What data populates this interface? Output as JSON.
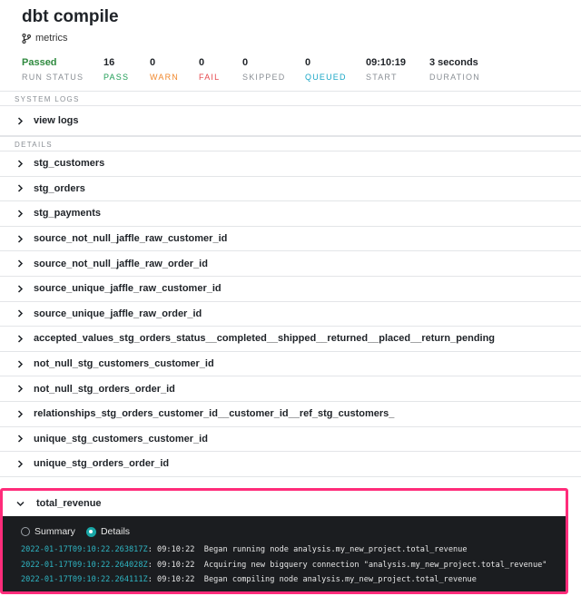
{
  "run": {
    "title": "dbt compile",
    "branch": "metrics"
  },
  "stats": [
    {
      "value": "Passed",
      "label": "RUN STATUS",
      "value_color": "#2f8a3f",
      "label_color": "#8a8f95",
      "width": 90
    },
    {
      "value": "16",
      "label": "PASS",
      "value_color": "#1f2328",
      "label_color": "#1f9d55",
      "width": 51
    },
    {
      "value": "0",
      "label": "WARN",
      "value_color": "#1f2328",
      "label_color": "#f0872c",
      "width": 54
    },
    {
      "value": "0",
      "label": "FAIL",
      "value_color": "#1f2328",
      "label_color": "#e5484d",
      "width": 48
    },
    {
      "value": "0",
      "label": "SKIPPED",
      "value_color": "#1f2328",
      "label_color": "#8a8f95",
      "width": 69
    },
    {
      "value": "0",
      "label": "QUEUED",
      "value_color": "#1f2328",
      "label_color": "#19a6c6",
      "width": 67
    },
    {
      "value": "09:10:19",
      "label": "START",
      "value_color": "#1f2328",
      "label_color": "#8a8f95",
      "width": 70
    },
    {
      "value": "3 seconds",
      "label": "DURATION",
      "value_color": "#1f2328",
      "label_color": "#8a8f95",
      "width": 80
    }
  ],
  "system_logs": {
    "section_label": "SYSTEM LOGS",
    "item": "view logs"
  },
  "details": {
    "section_label": "DETAILS",
    "nodes": [
      "stg_customers",
      "stg_orders",
      "stg_payments",
      "source_not_null_jaffle_raw_customer_id",
      "source_not_null_jaffle_raw_order_id",
      "source_unique_jaffle_raw_customer_id",
      "source_unique_jaffle_raw_order_id",
      "accepted_values_stg_orders_status__completed__shipped__returned__placed__return_pending",
      "not_null_stg_customers_customer_id",
      "not_null_stg_orders_order_id",
      "relationships_stg_orders_customer_id__customer_id__ref_stg_customers_",
      "unique_stg_customers_customer_id",
      "unique_stg_orders_order_id"
    ]
  },
  "expanded_node": {
    "name": "total_revenue",
    "tabs": {
      "summary": "Summary",
      "details": "Details",
      "selected": "details"
    },
    "logs": [
      {
        "timestamp": "2022-01-17T09:10:22.263817Z",
        "message": ": 09:10:22  Began running node analysis.my_new_project.total_revenue"
      },
      {
        "timestamp": "2022-01-17T09:10:22.264028Z",
        "message": ": 09:10:22  Acquiring new bigquery connection \"analysis.my_new_project.total_revenue\""
      },
      {
        "timestamp": "2022-01-17T09:10:22.264111Z",
        "message": ": 09:10:22  Began compiling node analysis.my_new_project.total_revenue"
      }
    ]
  },
  "colors": {
    "highlight_border": "#ff2c7a",
    "log_background": "#1b1d20",
    "timestamp": "#2fb5c3",
    "radio_selected": "#19a6a6"
  }
}
